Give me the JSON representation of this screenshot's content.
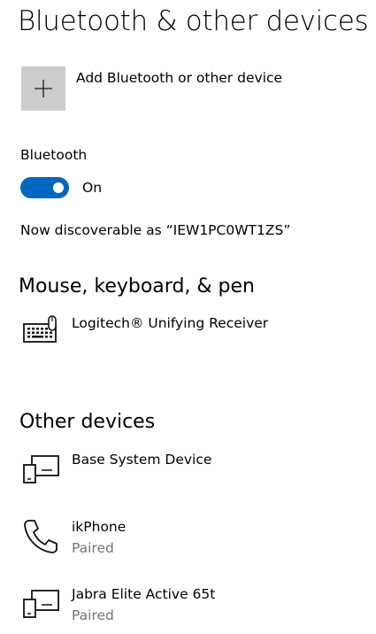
{
  "page": {
    "title": "Bluetooth & other devices"
  },
  "add_device": {
    "label": "Add Bluetooth or other device",
    "icon": "plus-icon"
  },
  "bluetooth": {
    "label": "Bluetooth",
    "toggle_state": "On",
    "enabled": true,
    "accent_color": "#0067c0",
    "discoverable_text": "Now discoverable as “IEW1PC0WT1ZS”"
  },
  "sections": {
    "mouse_keyboard_pen": {
      "title": "Mouse, keyboard, & pen",
      "devices": [
        {
          "name": "Logitech® Unifying Receiver",
          "icon": "keyboard-icon"
        }
      ]
    },
    "other_devices": {
      "title": "Other devices",
      "devices": [
        {
          "name": "Base System Device",
          "status": "",
          "icon": "device-icon"
        },
        {
          "name": "ikPhone",
          "status": "Paired",
          "icon": "phone-icon"
        },
        {
          "name": "Jabra Elite Active 65t",
          "status": "Paired",
          "icon": "device-icon"
        }
      ]
    }
  }
}
